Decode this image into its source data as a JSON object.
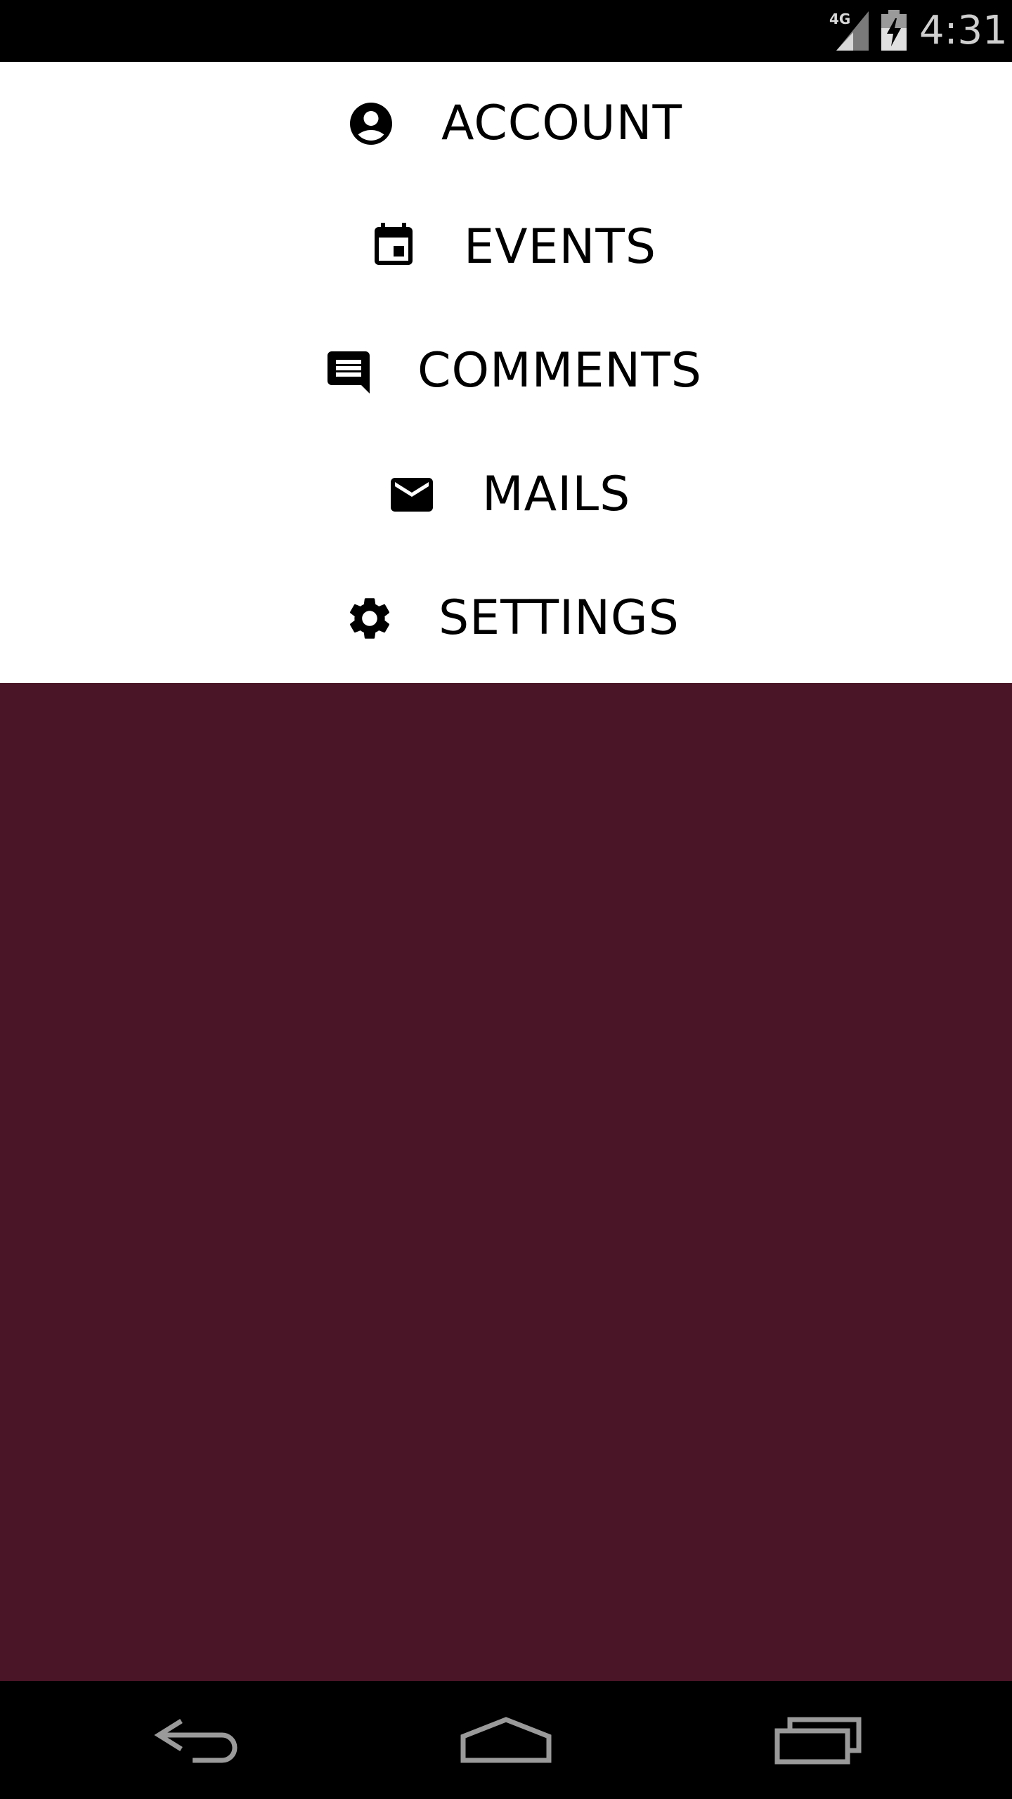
{
  "status_bar": {
    "network_type": "4G",
    "time": "4:31",
    "icons": [
      "signal-icon",
      "battery-charging-icon"
    ]
  },
  "menu": {
    "items": [
      {
        "label": "ACCOUNT",
        "icon": "account-circle-icon"
      },
      {
        "label": "EVENTS",
        "icon": "calendar-event-icon"
      },
      {
        "label": "COMMENTS",
        "icon": "comment-icon"
      },
      {
        "label": "MAILS",
        "icon": "mail-icon"
      },
      {
        "label": "SETTINGS",
        "icon": "gear-icon"
      }
    ]
  },
  "nav_bar": {
    "buttons": [
      "back-icon",
      "home-icon",
      "recents-icon"
    ]
  },
  "colors": {
    "content_background": "#4a1526",
    "menu_background": "#ffffff",
    "system_bar": "#000000",
    "status_text": "#cfcfcf"
  }
}
